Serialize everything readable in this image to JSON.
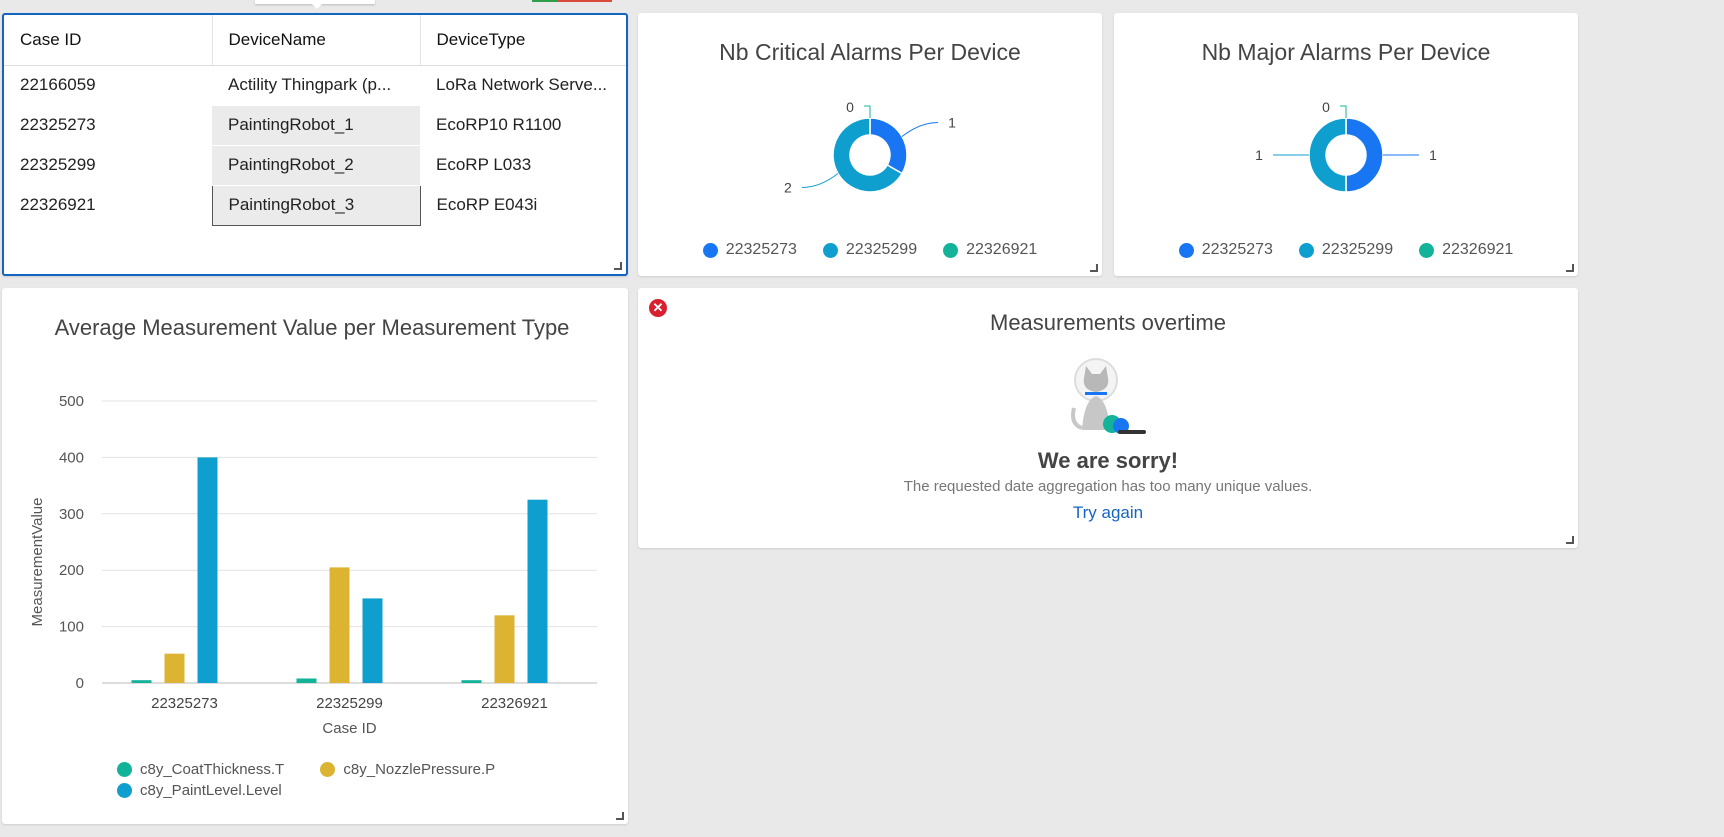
{
  "table": {
    "headers": [
      "Case ID",
      "DeviceName",
      "DeviceType"
    ],
    "rows": [
      [
        "22166059",
        "Actility Thingpark (p...",
        "LoRa Network Serve..."
      ],
      [
        "22325273",
        "PaintingRobot_1",
        "EcoRP10 R1100"
      ],
      [
        "22325299",
        "PaintingRobot_2",
        "EcoRP L033"
      ],
      [
        "22326921",
        "PaintingRobot_3",
        "EcoRP E043i"
      ]
    ]
  },
  "critical": {
    "title": "Nb Critical Alarms Per Device",
    "legend": [
      "22325273",
      "22325299",
      "22326921"
    ]
  },
  "major": {
    "title": "Nb Major Alarms Per Device",
    "legend": [
      "22325273",
      "22325299",
      "22326921"
    ]
  },
  "bar": {
    "title": "Average Measurement Value per Measurement Type",
    "legend": [
      "c8y_CoatThickness.T",
      "c8y_NozzlePressure.P",
      "c8y_PaintLevel.Level"
    ]
  },
  "measurements": {
    "title": "Measurements overtime",
    "sorry": "We are sorry!",
    "message": "The requested date aggregation has too many unique values.",
    "try_again": "Try again",
    "error_icon": "close-circle-icon"
  },
  "colors": {
    "accent": "#1565c0",
    "blue": "#1976f2",
    "teal": "#0f9fcf",
    "green": "#13b39a",
    "gold": "#dcb432",
    "error": "#d9202f"
  },
  "chart_data": [
    {
      "type": "pie",
      "title": "Nb Critical Alarms Per Device",
      "labels": [
        "22325273",
        "22325299",
        "22326921"
      ],
      "values": [
        1,
        2,
        0
      ],
      "colors": [
        "#1976f2",
        "#0f9fcf",
        "#13b39a"
      ]
    },
    {
      "type": "pie",
      "title": "Nb Major Alarms Per Device",
      "labels": [
        "22325273",
        "22325299",
        "22326921"
      ],
      "values": [
        1,
        1,
        0
      ],
      "colors": [
        "#1976f2",
        "#0f9fcf",
        "#13b39a"
      ]
    },
    {
      "type": "bar",
      "title": "Average Measurement Value per Measurement Type",
      "categories": [
        "22325273",
        "22325299",
        "22326921"
      ],
      "series": [
        {
          "name": "c8y_CoatThickness.T",
          "values": [
            5,
            8,
            5
          ],
          "color": "#13b39a"
        },
        {
          "name": "c8y_NozzlePressure.P",
          "values": [
            52,
            205,
            120
          ],
          "color": "#dcb432"
        },
        {
          "name": "c8y_PaintLevel.Level",
          "values": [
            400,
            150,
            325
          ],
          "color": "#0f9fcf"
        }
      ],
      "xlabel": "Case ID",
      "ylabel": "MeasurementValue",
      "ylim": [
        0,
        500
      ],
      "yticks": [
        0,
        100,
        200,
        300,
        400,
        500
      ],
      "grid": true,
      "legend": "bottom"
    }
  ]
}
